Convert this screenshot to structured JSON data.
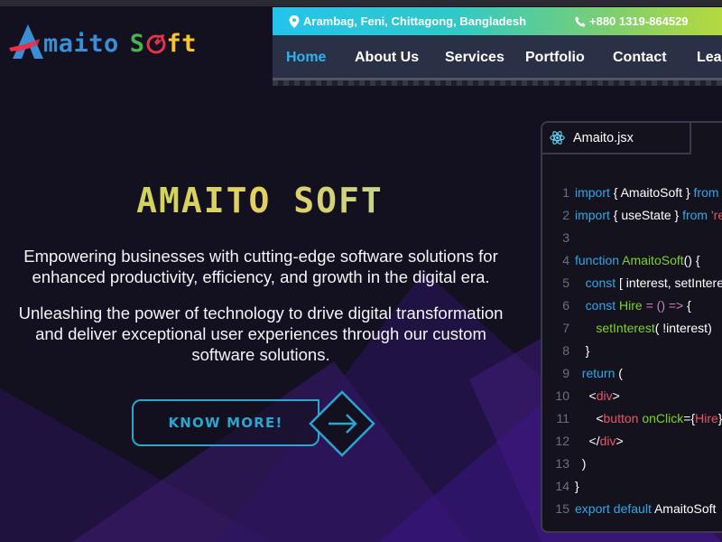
{
  "logo": {
    "text_part1": "maito",
    "text_part2_s": "S",
    "text_part2_ft": "ft"
  },
  "contact": {
    "address": "Arambag, Feni, Chittagong, Bangladesh",
    "phone": "+880 1319-864529"
  },
  "nav": {
    "items": [
      {
        "label": "Home",
        "active": true
      },
      {
        "label": "About Us"
      },
      {
        "label": "Services"
      },
      {
        "label": "Portfolio"
      },
      {
        "label": "Contact"
      },
      {
        "label": "Lea"
      }
    ]
  },
  "hero": {
    "title": "AMAITO SOFT",
    "paragraph1_line1": "Empowering businesses with cutting-edge software solutions for",
    "paragraph1_line2": "enhanced productivity, efficiency, and growth in the digital era.",
    "paragraph2_line1": "Unleashing the power of technology to drive digital transformation",
    "paragraph2_line2": "and deliver exceptional user experiences through our custom",
    "paragraph2_line3": "software solutions.",
    "button_label": "KNOW MORE!"
  },
  "code": {
    "filename": "Amaito.jsx",
    "lines": [
      {
        "n": "1",
        "parts": [
          [
            "kw",
            "import "
          ],
          [
            "tx",
            "{ AmaitoSoft } "
          ],
          [
            "kw",
            "from "
          ]
        ]
      },
      {
        "n": "2",
        "parts": [
          [
            "kw",
            "import "
          ],
          [
            "tx",
            "{ useState } "
          ],
          [
            "kw",
            "from "
          ],
          [
            "tg",
            "'re"
          ]
        ]
      },
      {
        "n": "3",
        "parts": []
      },
      {
        "n": "4",
        "parts": [
          [
            "kw",
            "function "
          ],
          [
            "fn",
            "AmaitoSoft"
          ],
          [
            "tx",
            "() {"
          ]
        ]
      },
      {
        "n": "5",
        "parts": [
          [
            "tx",
            "   "
          ],
          [
            "kw",
            "const "
          ],
          [
            "tx",
            "[ interest, setIntere"
          ]
        ]
      },
      {
        "n": "6",
        "parts": [
          [
            "tx",
            "   "
          ],
          [
            "kw",
            "const "
          ],
          [
            "fn",
            "Hire "
          ],
          [
            "op",
            "= () => "
          ],
          [
            "tx",
            "{"
          ]
        ]
      },
      {
        "n": "7",
        "parts": [
          [
            "tx",
            "      "
          ],
          [
            "fn",
            "setInterest"
          ],
          [
            "tx",
            "( !interest)"
          ]
        ]
      },
      {
        "n": "8",
        "parts": [
          [
            "tx",
            "   }"
          ]
        ]
      },
      {
        "n": "9",
        "parts": [
          [
            "tx",
            "  "
          ],
          [
            "kw",
            "return "
          ],
          [
            "tx",
            "("
          ]
        ]
      },
      {
        "n": "10",
        "parts": [
          [
            "tx",
            "    <"
          ],
          [
            "tg",
            "div"
          ],
          [
            "tx",
            ">"
          ]
        ]
      },
      {
        "n": "11",
        "parts": [
          [
            "tx",
            "      <"
          ],
          [
            "tg",
            "button "
          ],
          [
            "fn",
            "onClick"
          ],
          [
            "tx",
            "={"
          ],
          [
            "tg",
            "Hire"
          ],
          [
            "tx",
            "}"
          ]
        ]
      },
      {
        "n": "12",
        "parts": [
          [
            "tx",
            "    </"
          ],
          [
            "tg",
            "div"
          ],
          [
            "tx",
            ">"
          ]
        ]
      },
      {
        "n": "13",
        "parts": [
          [
            "tx",
            "  )"
          ]
        ]
      },
      {
        "n": "14",
        "parts": [
          [
            "tx",
            "}"
          ]
        ]
      },
      {
        "n": "15",
        "parts": [
          [
            "kw",
            "export default "
          ],
          [
            "tx",
            "AmaitoSoft"
          ]
        ]
      }
    ]
  },
  "colors": {
    "accent_blue": "#29b6f0",
    "button_cyan": "#2aa6cf",
    "nav_bg": "#2a3147",
    "page_bg": "#13101f"
  }
}
